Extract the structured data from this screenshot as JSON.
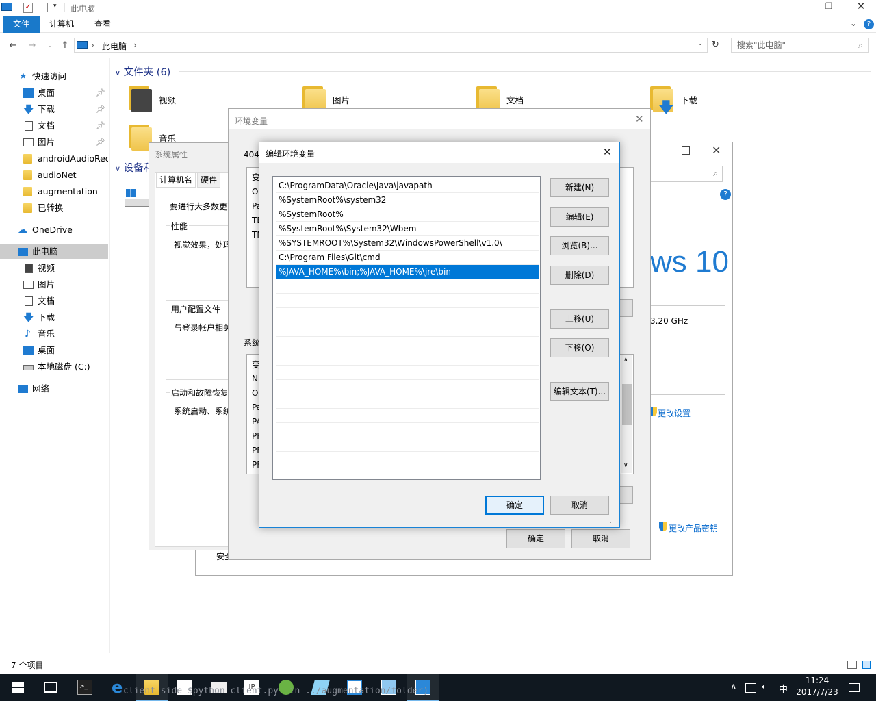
{
  "explorer": {
    "title": "此电脑",
    "tabs": [
      "文件",
      "计算机",
      "查看"
    ],
    "address": "此电脑",
    "search_placeholder": "搜索\"此电脑\"",
    "folders_header": "文件夹 (6)",
    "devices_header": "设备和",
    "folders": [
      "视频",
      "图片",
      "文档",
      "下载",
      "音乐"
    ],
    "status": "7 个项目"
  },
  "nav": {
    "quick_access": "快速访问",
    "quick_items": [
      "桌面",
      "下载",
      "文档",
      "图片",
      "androidAudioRec",
      "audioNet",
      "augmentation",
      "已转换"
    ],
    "onedrive": "OneDrive",
    "this_pc": "此电脑",
    "pc_items": [
      "视频",
      "图片",
      "文档",
      "下载",
      "音乐",
      "桌面",
      "本地磁盘 (C:)"
    ],
    "network": "网络"
  },
  "sysinfo": {
    "windows_logo_text": "ws 10",
    "cpu_speed": "3.20 GHz",
    "change_settings": "更改设置",
    "change_key": "更改产品密钥",
    "security": "安全"
  },
  "sysprops": {
    "title": "系统属性",
    "tabs": [
      "计算机名",
      "硬件"
    ],
    "admin_note": "要进行大多数更改",
    "perf_label": "性能",
    "perf_text": "视觉效果，处理",
    "profile_label": "用户配置文件",
    "profile_text": "与登录帐户相关",
    "startup_label": "启动和故障恢复",
    "startup_text": "系统启动、系统"
  },
  "envvars": {
    "title": "环境变量",
    "user_label": "404",
    "user_rows": [
      "变",
      "O",
      "Pa",
      "TE",
      "TN"
    ],
    "sys_label": "系统",
    "sys_rows": [
      "变",
      "N",
      "O",
      "Pa",
      "PA",
      "PF",
      "PF",
      "PF"
    ],
    "ok": "确定",
    "cancel": "取消"
  },
  "editenv": {
    "title": "编辑环境变量",
    "paths": [
      "C:\\ProgramData\\Oracle\\Java\\javapath",
      "%SystemRoot%\\system32",
      "%SystemRoot%",
      "%SystemRoot%\\System32\\Wbem",
      "%SYSTEMROOT%\\System32\\WindowsPowerShell\\v1.0\\",
      "C:\\Program Files\\Git\\cmd",
      "%JAVA_HOME%\\bin;%JAVA_HOME%\\jre\\bin"
    ],
    "selected_index": 6,
    "buttons": {
      "new": "新建(N)",
      "edit": "编辑(E)",
      "browse": "浏览(B)...",
      "delete": "删除(D)",
      "up": "上移(U)",
      "down": "下移(O)",
      "edit_text": "编辑文本(T)..."
    },
    "ok": "确定",
    "cancel": "取消"
  },
  "taskbar": {
    "time": "11:24",
    "date": "2017/7/23",
    "ime": "中",
    "ghost_text": "client side $python client.py -in ../augmentation/folder)"
  }
}
